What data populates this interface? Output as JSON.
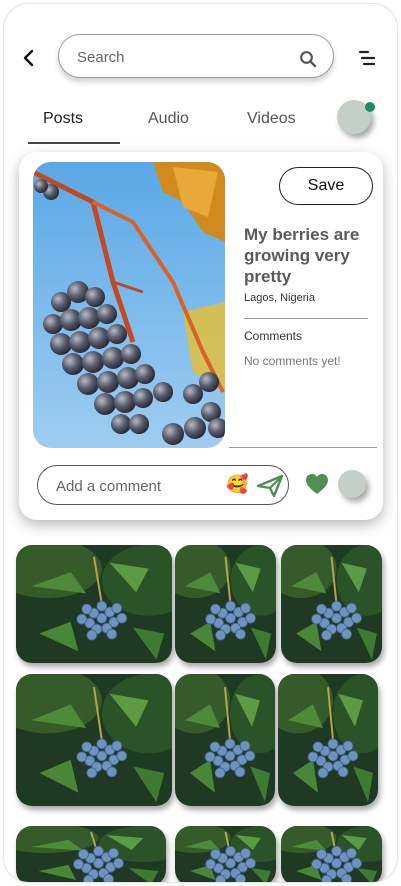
{
  "search": {
    "placeholder": "Search"
  },
  "tabs": [
    {
      "label": "Posts",
      "active": true
    },
    {
      "label": "Audio",
      "active": false
    },
    {
      "label": "Videos",
      "active": false
    }
  ],
  "post": {
    "image": "grapes-on-vine",
    "save_label": "Save",
    "title": "My berries are growing very pretty",
    "location": "Lagos, Nigeria",
    "comments_heading": "Comments",
    "no_comments": "No comments yet!",
    "comment_placeholder": "Add a comment",
    "emoji": "🥰"
  },
  "gallery": {
    "image": "blue-berries-holly-leaves",
    "count": 9
  },
  "colors": {
    "accent_green": "#4f8f55",
    "status_dot": "#1e8a66",
    "avatar_bg": "#c4d0c7"
  }
}
